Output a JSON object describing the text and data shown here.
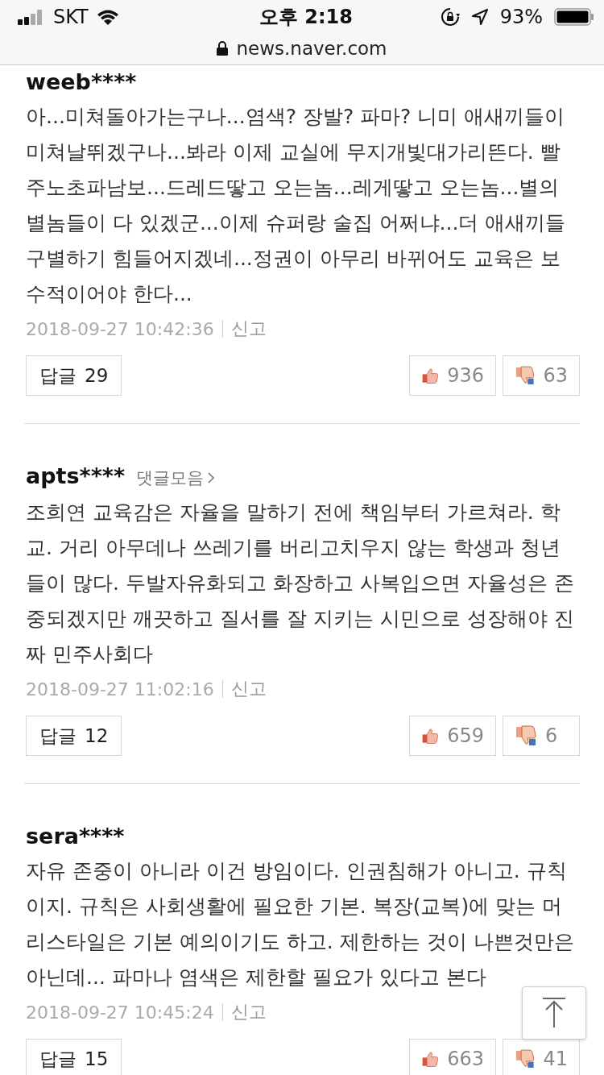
{
  "status_bar": {
    "carrier": "SKT",
    "time": "오후 2:18",
    "battery": "93%"
  },
  "url_bar": {
    "address": "news.naver.com"
  },
  "comments": [
    {
      "user": "weeb****",
      "text": "아...미쳐돌아가는구나...염색? 장발? 파마? 니미 애새끼들이 미쳐날뛰겠구나...봐라 이제 교실에 무지개빛대가리뜬다. 빨주노초파남보...드레드땋고 오는놈...레게땋고 오는놈...별의 별놈들이 다 있겠군...이제 슈퍼랑 술집 어쩌냐...더 애새끼들 구별하기 힘들어지겠네...정권이 아무리 바뀌어도 교육은 보수적이어야 한다...",
      "date": "2018-09-27 10:42:36",
      "report": "신고",
      "reply_label": "답글",
      "reply_count": "29",
      "likes": "936",
      "dislikes": "63"
    },
    {
      "user": "apts****",
      "collection_link": "댓글모음",
      "text": "조희연 교육감은 자율을 말하기 전에 책임부터 가르쳐라. 학교. 거리 아무데나 쓰레기를 버리고치우지 않는 학생과 청년들이 많다. 두발자유화되고 화장하고 사복입으면 자율성은 존중되겠지만 깨끗하고 질서를 잘 지키는 시민으로 성장해야 진짜 민주사회다",
      "date": "2018-09-27 11:02:16",
      "report": "신고",
      "reply_label": "답글",
      "reply_count": "12",
      "likes": "659",
      "dislikes": "6"
    },
    {
      "user": "sera****",
      "text": "자유 존중이 아니라 이건 방임이다. 인권침해가 아니고. 규칙이지. 규칙은 사회생활에 필요한 기본. 복장(교복)에 맞는 머리스타일은 기본 예의이기도 하고. 제한하는 것이 나쁜것만은 아닌데... 파마나 염색은 제한할 필요가 있다고 본다",
      "date": "2018-09-27 10:45:24",
      "report": "신고",
      "reply_label": "답글",
      "reply_count": "15",
      "likes": "663",
      "dislikes": "41"
    }
  ]
}
